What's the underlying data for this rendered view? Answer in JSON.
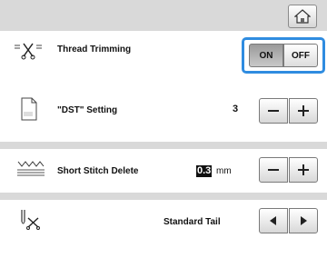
{
  "header": {
    "home_icon": "home-icon"
  },
  "settings": {
    "thread_trimming": {
      "label": "Thread Trimming",
      "on_label": "ON",
      "off_label": "OFF",
      "selected": "ON"
    },
    "dst_setting": {
      "label": "\"DST\" Setting",
      "value": "3"
    },
    "short_stitch_delete": {
      "label": "Short Stitch Delete",
      "value": "0.3",
      "unit": "mm"
    },
    "tail_setting": {
      "value": "Standard Tail"
    }
  },
  "colors": {
    "accent": "#2f8ce0",
    "background": "#d9d9d9",
    "panel": "#ffffff"
  }
}
